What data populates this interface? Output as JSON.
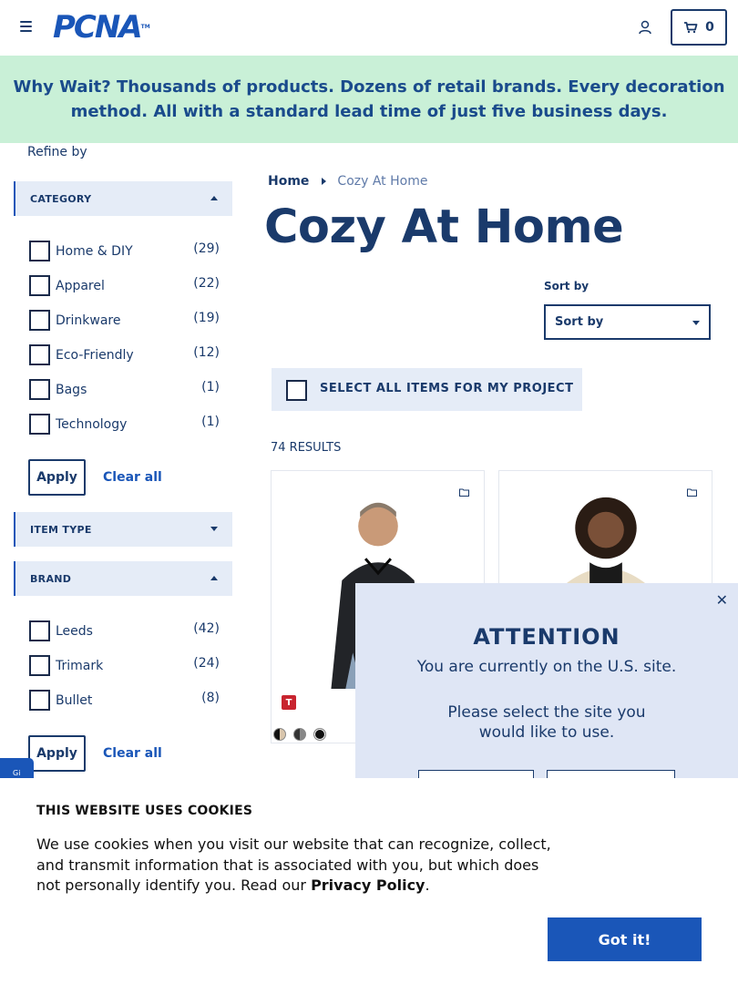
{
  "header": {
    "logo": "PCNA",
    "logo_tm": "TM",
    "cart_count": "0",
    "icons": [
      "menu-icon",
      "user-icon",
      "cart-icon"
    ]
  },
  "promo": {
    "text": "Why Wait? Thousands of products. Dozens of retail brands. Every decoration method. All with a standard lead time of just five business days."
  },
  "sidebar": {
    "refine_label": "Refine by",
    "category": {
      "title": "CATEGORY",
      "items": [
        {
          "label": "Home & DIY",
          "count": "(29)"
        },
        {
          "label": "Apparel",
          "count": "(22)"
        },
        {
          "label": "Drinkware",
          "count": "(19)"
        },
        {
          "label": "Eco-Friendly",
          "count": "(12)"
        },
        {
          "label": "Bags",
          "count": "(1)"
        },
        {
          "label": "Technology",
          "count": "(1)"
        }
      ],
      "apply": "Apply",
      "clear": "Clear all"
    },
    "item_type": {
      "title": "ITEM TYPE"
    },
    "brand": {
      "title": "BRAND",
      "items": [
        {
          "label": "Leeds",
          "count": "(42)"
        },
        {
          "label": "Trimark",
          "count": "(24)"
        },
        {
          "label": "Bullet",
          "count": "(8)"
        }
      ],
      "apply": "Apply",
      "clear": "Clear all"
    },
    "side_tab": "Gi"
  },
  "main": {
    "breadcrumb": {
      "home": "Home",
      "current": "Cozy At Home"
    },
    "title": "Cozy At Home",
    "sort_label": "Sort by",
    "sort_value": "Sort by",
    "select_all": "SELECT ALL ITEMS FOR MY PROJECT",
    "results": "74 RESULTS",
    "products": [
      {
        "badge": "T",
        "swatch_colors": [
          "#d9c6ad",
          "#555555",
          "#111111"
        ]
      },
      {
        "badge": "",
        "swatch_colors": []
      }
    ]
  },
  "modal": {
    "title": "ATTENTION",
    "line1": "You are currently on the U.S. site.",
    "line2a": "Please select the site you",
    "line2b": "would like to use.",
    "close": "✕"
  },
  "cookie": {
    "title": "THIS WEBSITE USES COOKIES",
    "text": "We use cookies when you visit our website that can recognize, collect, and transmit information that is associated with you, but which does not personally identify you. Read our",
    "link": "Privacy Policy",
    "after": ".",
    "button": "Got it!"
  },
  "colors": {
    "brand_blue": "#1a56b8",
    "navy": "#1a3a6b",
    "promo_bg": "#c9f0d7",
    "facet_bg": "#e5ecf7"
  }
}
